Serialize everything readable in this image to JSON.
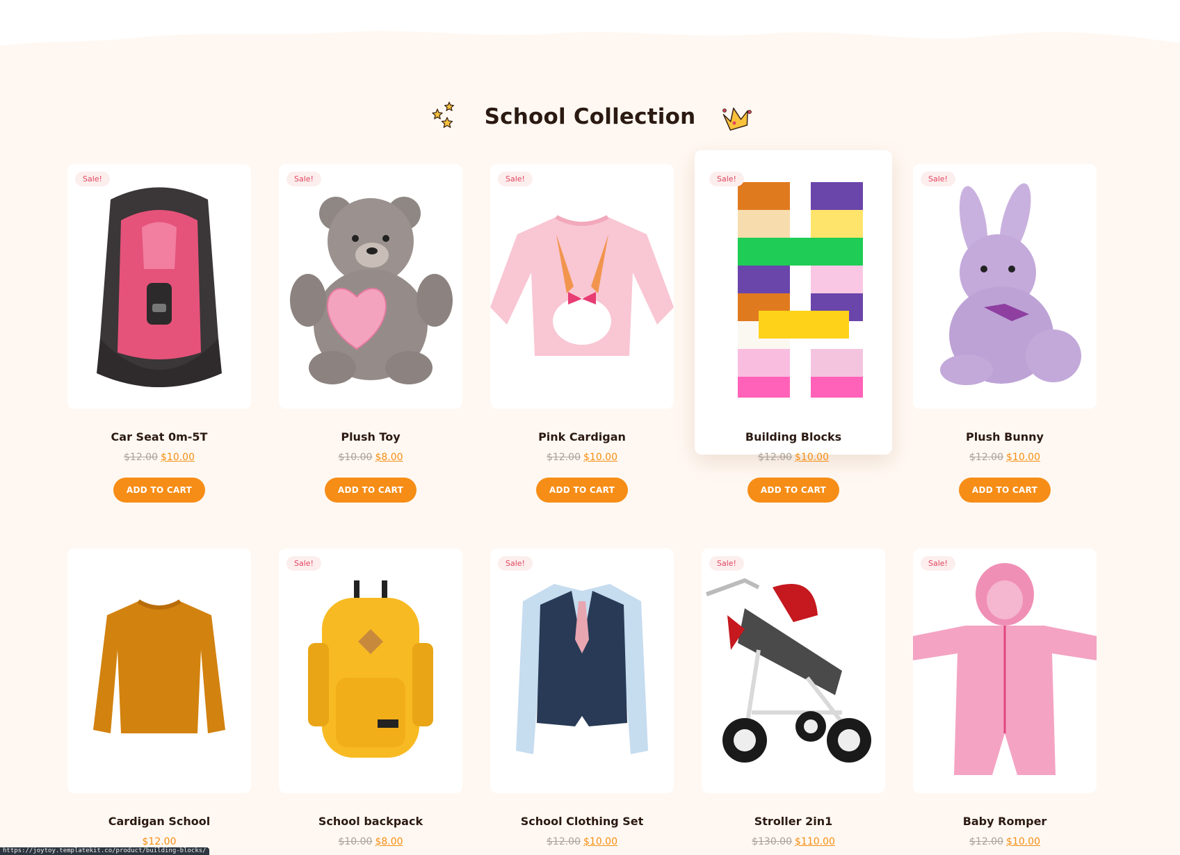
{
  "section": {
    "title": "School Collection",
    "colors": {
      "background": "#fff8f2",
      "accent": "#f68d16",
      "sale_text": "#e0455e",
      "sale_bg": "#fdeeee"
    },
    "left_decoration_icon": "stars-icon",
    "right_decoration_icon": "crown-icon"
  },
  "products": [
    {
      "name": "Car Seat 0m-5T",
      "sale_badge": "Sale!",
      "old_price": "$12.00",
      "price": "$10.00",
      "button": "ADD TO CART",
      "image": "car-seat-image"
    },
    {
      "name": "Plush Toy",
      "sale_badge": "Sale!",
      "old_price": "$10.00",
      "price": "$8.00",
      "button": "ADD TO CART",
      "image": "teddy-bear-image"
    },
    {
      "name": "Pink Cardigan",
      "sale_badge": "Sale!",
      "old_price": "$12.00",
      "price": "$10.00",
      "button": "ADD TO CART",
      "image": "pink-sweater-image"
    },
    {
      "name": "Building Blocks",
      "sale_badge": "Sale!",
      "old_price": "$12.00",
      "price": "$10.00",
      "button": "ADD TO CART",
      "image": "building-blocks-image",
      "hovered": true
    },
    {
      "name": "Plush Bunny",
      "sale_badge": "Sale!",
      "old_price": "$12.00",
      "price": "$10.00",
      "button": "ADD TO CART",
      "image": "plush-bunny-image"
    },
    {
      "name": "Cardigan School",
      "sale_badge": "",
      "old_price": "",
      "price": "$12.00",
      "button": "",
      "image": "orange-sweater-image"
    },
    {
      "name": "School backpack",
      "sale_badge": "Sale!",
      "old_price": "$10.00",
      "price": "$8.00",
      "button": "",
      "image": "backpack-image"
    },
    {
      "name": "School Clothing Set",
      "sale_badge": "Sale!",
      "old_price": "$12.00",
      "price": "$10.00",
      "button": "",
      "image": "vest-suit-image"
    },
    {
      "name": "Stroller 2in1",
      "sale_badge": "Sale!",
      "old_price": "$130.00",
      "price": "$110.00",
      "button": "",
      "image": "stroller-image"
    },
    {
      "name": "Baby Romper",
      "sale_badge": "Sale!",
      "old_price": "$12.00",
      "price": "$10.00",
      "button": "",
      "image": "pink-romper-image"
    }
  ],
  "status_bar": {
    "url": "https://joytoy.templatekit.co/product/building-blocks/"
  }
}
